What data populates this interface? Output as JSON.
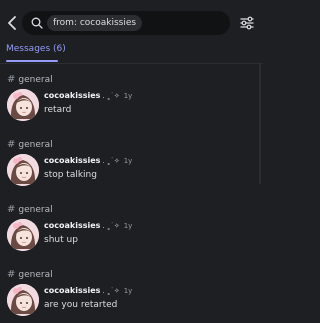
{
  "header": {
    "back_icon": "chevron-left-icon",
    "search_icon": "magnifier-icon",
    "search_chip": "from: cocoakissies",
    "filter_icon": "sliders-icon"
  },
  "tabs": {
    "messages_label": "Messages (6)"
  },
  "results": [
    {
      "channel": "general",
      "author": "cocoakissies",
      "decoration": ". ˳˙✧",
      "time": "1y",
      "text": "retard"
    },
    {
      "channel": "general",
      "author": "cocoakissies",
      "decoration": ". ˳˙✧",
      "time": "1y",
      "text": "stop talking"
    },
    {
      "channel": "general",
      "author": "cocoakissies",
      "decoration": ". ˳˙✧",
      "time": "1y",
      "text": "shut up"
    },
    {
      "channel": "general",
      "author": "cocoakissies",
      "decoration": ". ˳˙✧",
      "time": "1y",
      "text": "are you retarted"
    }
  ],
  "colors": {
    "background": "#1e1f22",
    "accent": "#949cf7",
    "search_bg": "#111214"
  }
}
